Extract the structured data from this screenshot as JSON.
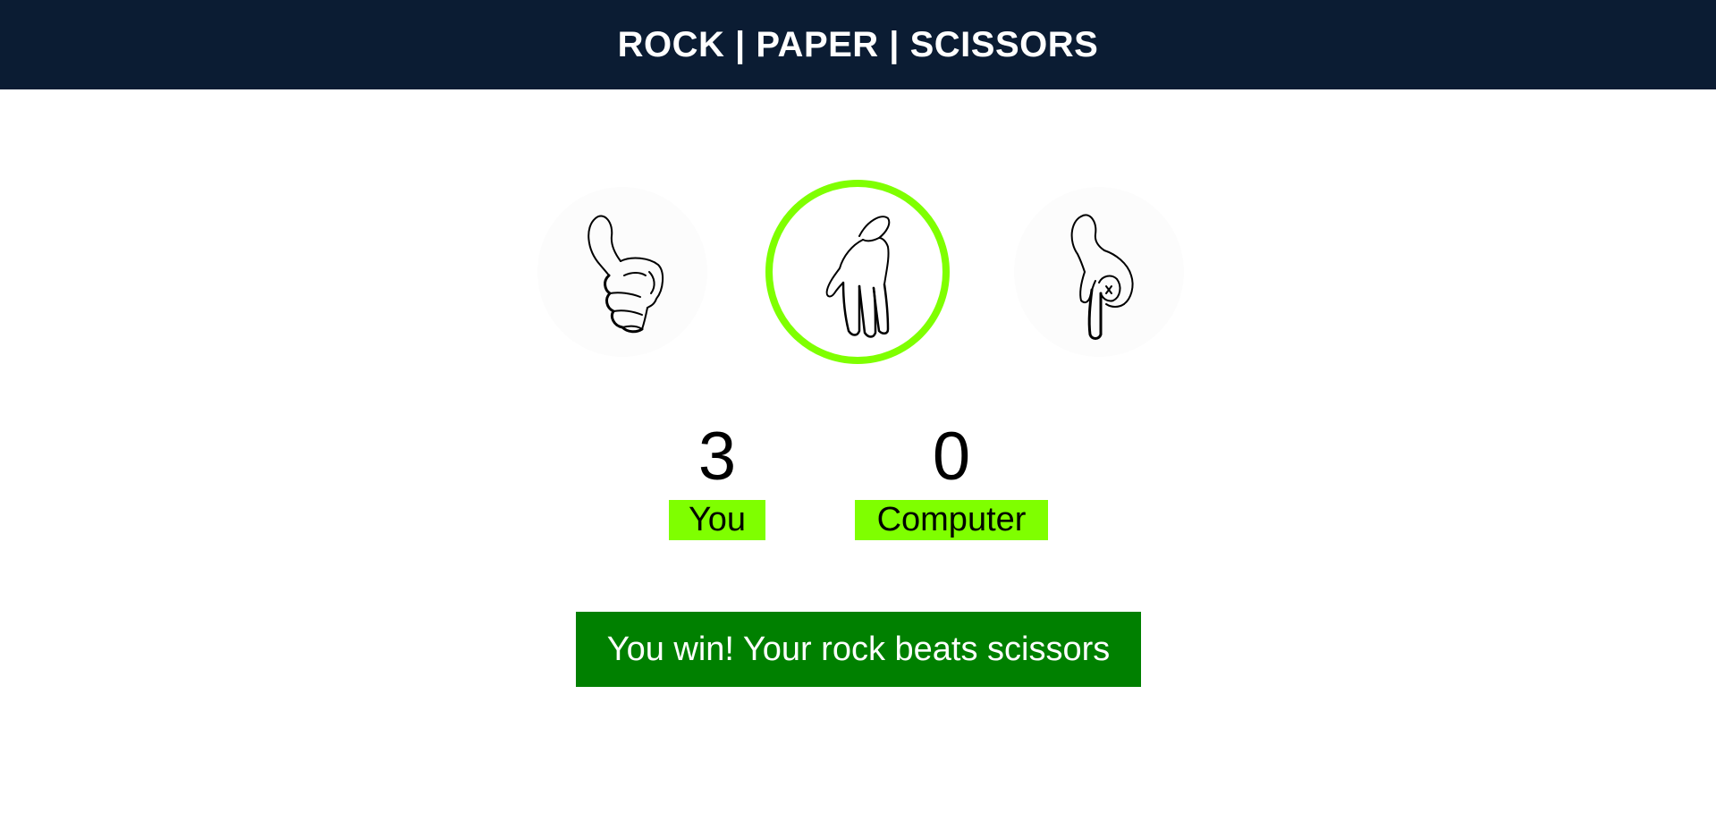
{
  "header": {
    "title": "ROCK | PAPER | SCISSORS"
  },
  "choices": [
    {
      "id": "rock",
      "icon": "rock-hand-icon",
      "selected": false
    },
    {
      "id": "paper",
      "icon": "paper-hand-icon",
      "selected": true
    },
    {
      "id": "scissors",
      "icon": "scissors-hand-icon",
      "selected": false
    }
  ],
  "scoreboard": {
    "user_score": "3",
    "user_label": "You",
    "computer_score": "0",
    "computer_label": "Computer"
  },
  "result": {
    "message": "You win! Your rock beats scissors"
  },
  "colors": {
    "header_bg": "#0b1c33",
    "accent_green": "#7fff00",
    "result_bg": "#008000"
  }
}
